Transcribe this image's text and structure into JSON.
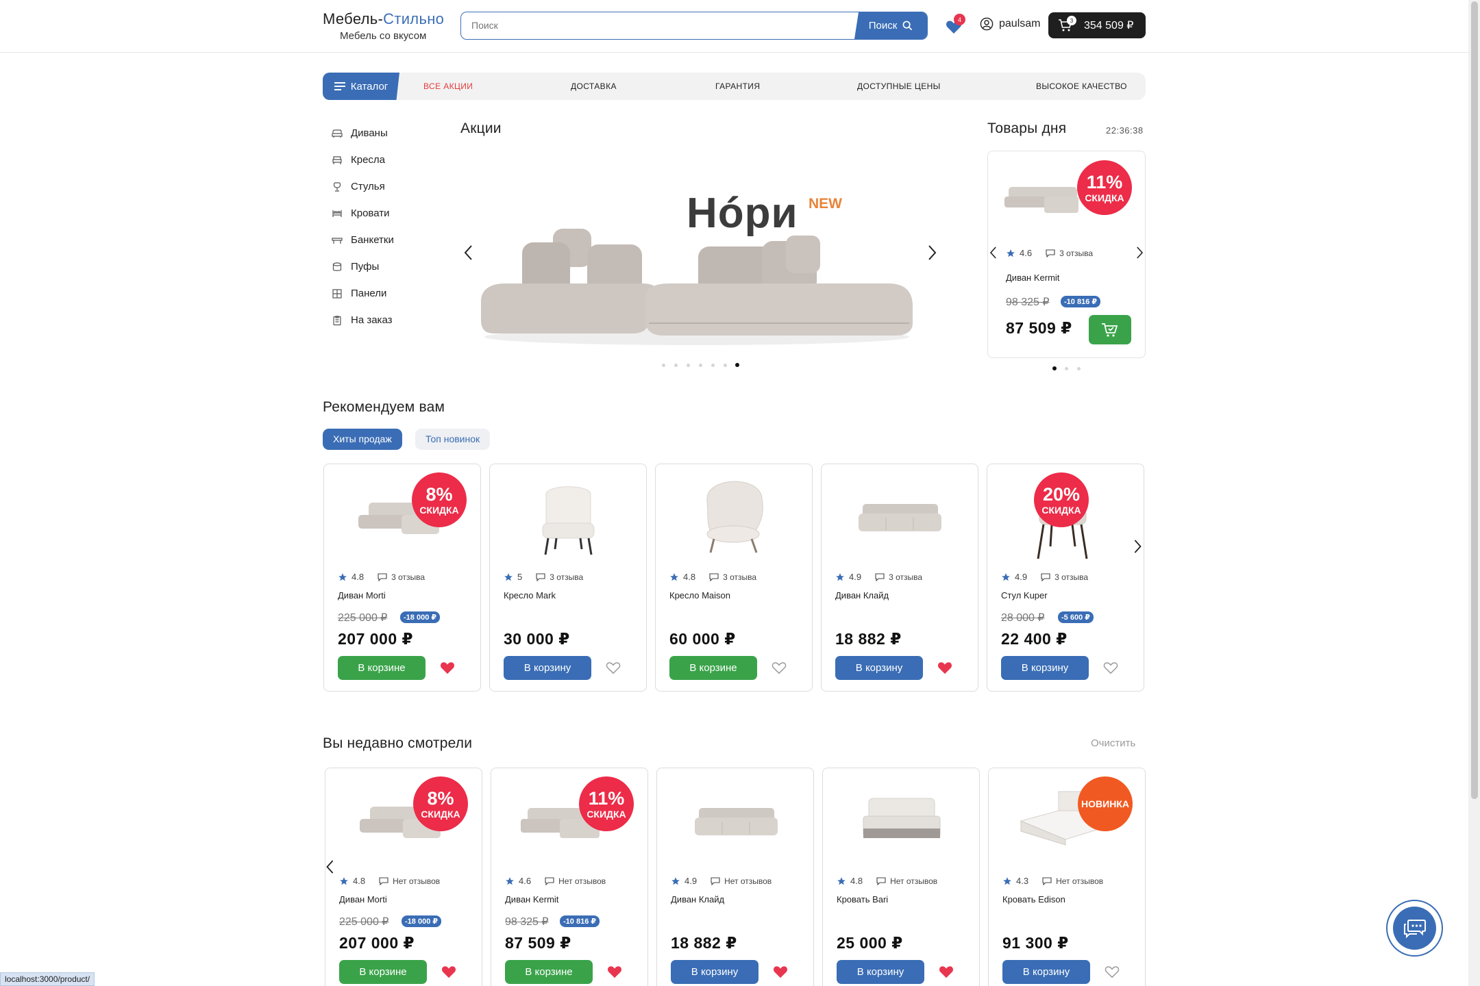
{
  "header": {
    "logo_part1": "Мебель-",
    "logo_part2": "Стильно",
    "tagline": "Мебель со вкусом",
    "search_placeholder": "Поиск",
    "search_button": "Поиск",
    "favorites_count": "4",
    "username": "paulsam",
    "cart_count": "3",
    "cart_total": "354 509 ₽"
  },
  "nav": {
    "catalog": "Каталог",
    "links": [
      "ВСЕ АКЦИИ",
      "ДОСТАВКА",
      "ГАРАНТИЯ",
      "ДОСТУПНЫЕ ЦЕНЫ",
      "ВЫСОКОЕ КАЧЕСТВО"
    ]
  },
  "sidebar": {
    "items": [
      "Диваны",
      "Кресла",
      "Стулья",
      "Кровати",
      "Банкетки",
      "Пуфы",
      "Панели",
      "На заказ"
    ]
  },
  "promo": {
    "title": "Акции",
    "banner_title": "Нóри",
    "banner_badge": "NEW",
    "slides": 7,
    "active_slide": 7
  },
  "day": {
    "title": "Товары дня",
    "timer": "22:36:38",
    "product": {
      "discount_pct": "11%",
      "discount_label": "СКИДКА",
      "rating": "4.6",
      "reviews": "3 отзыва",
      "name": "Диван Kermit",
      "old_price": "98 325 ₽",
      "diff": "-10 816 ₽",
      "price": "87 509 ₽"
    },
    "slides": 3,
    "active_slide": 1
  },
  "recommend": {
    "title": "Рекомендуем вам",
    "tabs": [
      "Хиты продаж",
      "Топ новинок"
    ],
    "active_tab": 0,
    "products": [
      {
        "name": "Диван Morti",
        "rating": "4.8",
        "reviews": "3 отзыва",
        "badge": "8%",
        "badge_label": "СКИДКА",
        "old_price": "225 000 ₽",
        "diff": "-18 000 ₽",
        "price": "207 000 ₽",
        "button": "В корзине",
        "in_cart": true,
        "favorite": true
      },
      {
        "name": "Кресло Mark",
        "rating": "5",
        "reviews": "3 отзыва",
        "price": "30 000 ₽",
        "button": "В корзину",
        "in_cart": false,
        "favorite": false
      },
      {
        "name": "Кресло Maison",
        "rating": "4.8",
        "reviews": "3 отзыва",
        "price": "60 000 ₽",
        "button": "В корзине",
        "in_cart": true,
        "favorite": false
      },
      {
        "name": "Диван Клайд",
        "rating": "4.9",
        "reviews": "3 отзыва",
        "price": "18 882 ₽",
        "button": "В корзину",
        "in_cart": false,
        "favorite": true
      },
      {
        "name": "Стул Kuper",
        "rating": "4.9",
        "reviews": "3 отзыва",
        "badge": "20%",
        "badge_label": "СКИДКА",
        "old_price": "28 000 ₽",
        "diff": "-5 600 ₽",
        "price": "22 400 ₽",
        "button": "В корзину",
        "in_cart": false,
        "favorite": false
      }
    ]
  },
  "recent": {
    "title": "Вы недавно смотрели",
    "clear": "Очистить",
    "products": [
      {
        "name": "Диван Morti",
        "rating": "4.8",
        "reviews": "Нет отзывов",
        "badge": "8%",
        "badge_label": "СКИДКА",
        "old_price": "225 000 ₽",
        "diff": "-18 000 ₽",
        "price": "207 000 ₽",
        "button": "В корзине",
        "in_cart": true,
        "favorite": true
      },
      {
        "name": "Диван Kermit",
        "rating": "4.6",
        "reviews": "Нет отзывов",
        "badge": "11%",
        "badge_label": "СКИДКА",
        "old_price": "98 325 ₽",
        "diff": "-10 816 ₽",
        "price": "87 509 ₽",
        "button": "В корзине",
        "in_cart": true,
        "favorite": true
      },
      {
        "name": "Диван Клайд",
        "rating": "4.9",
        "reviews": "Нет отзывов",
        "price": "18 882 ₽",
        "button": "В корзину",
        "in_cart": false,
        "favorite": true
      },
      {
        "name": "Кровать Bari",
        "rating": "4.8",
        "reviews": "Нет отзывов",
        "price": "25 000 ₽",
        "button": "В корзину",
        "in_cart": false,
        "favorite": true
      },
      {
        "name": "Кровать Edison",
        "rating": "4.3",
        "reviews": "Нет отзывов",
        "new_badge": "НОВИНКА",
        "price": "91 300 ₽",
        "button": "В корзину",
        "in_cart": false,
        "favorite": false
      }
    ]
  },
  "status_bar": "localhost:3000/product/",
  "colors": {
    "accent": "#3a6db5",
    "green": "#3aa34a",
    "red": "#ec2c48",
    "orange": "#f05a22"
  }
}
